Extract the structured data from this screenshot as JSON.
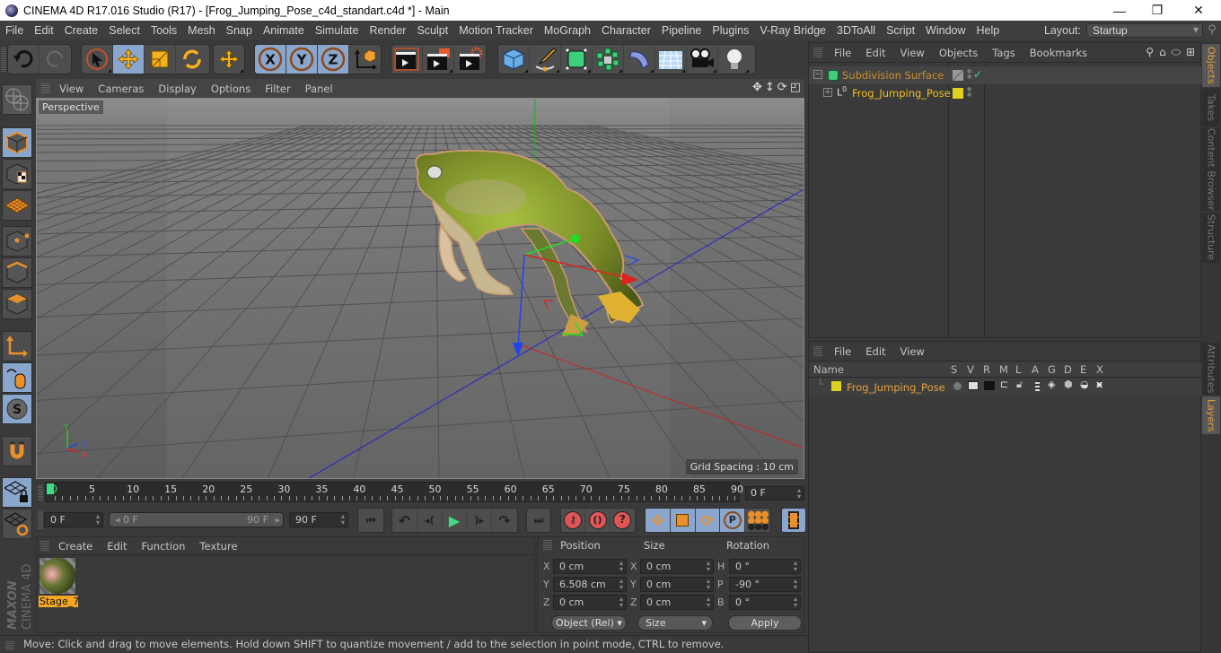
{
  "window": {
    "title": "CINEMA 4D R17.016 Studio (R17) - [Frog_Jumping_Pose_c4d_standart.c4d *] - Main",
    "controls": [
      "minimize",
      "maximize",
      "close"
    ]
  },
  "menubar": {
    "items": [
      "File",
      "Edit",
      "Create",
      "Select",
      "Tools",
      "Mesh",
      "Snap",
      "Animate",
      "Simulate",
      "Render",
      "Sculpt",
      "Motion Tracker",
      "MoGraph",
      "Character",
      "Pipeline",
      "Plugins",
      "V-Ray Bridge",
      "3DToAll",
      "Script",
      "Window",
      "Help"
    ],
    "layout_label": "Layout:",
    "layout_value": "Startup"
  },
  "toolbar": {
    "groups": [
      [
        "undo",
        "redo"
      ],
      [
        "live-selection",
        "move",
        "scale",
        "rotate"
      ],
      [
        "recent-tool-move"
      ],
      [
        "lock-x",
        "lock-y",
        "lock-z",
        "coordinate-system"
      ],
      [
        "render-view",
        "render-picture-viewer",
        "render-settings"
      ],
      [
        "cube",
        "pen",
        "subdivision-surface",
        "array",
        "bend-deformer",
        "floor",
        "camera",
        "light"
      ]
    ],
    "active": [
      "move",
      "lock-x",
      "lock-y",
      "lock-z"
    ]
  },
  "left_toolbar": {
    "items": [
      "make-editable",
      "model-mode",
      "texture-mode",
      "workplane-mode",
      "points-mode",
      "edges-mode",
      "polygons-mode",
      "axis-mode",
      "tweak-mode",
      "snapping",
      "magnet",
      "workplane-lock",
      "workplane-align"
    ],
    "active": [
      "model-mode",
      "tweak-mode",
      "snapping",
      "workplane-lock"
    ]
  },
  "viewport": {
    "menu": [
      "View",
      "Cameras",
      "Display",
      "Options",
      "Filter",
      "Panel"
    ],
    "camera_label": "Perspective",
    "grid_spacing": "Grid Spacing : 10 cm",
    "axis_labels": [
      "Y",
      "Z",
      "X"
    ]
  },
  "timeline": {
    "tick_labels": [
      "0",
      "5",
      "10",
      "15",
      "20",
      "25",
      "30",
      "35",
      "40",
      "45",
      "50",
      "55",
      "60",
      "65",
      "70",
      "75",
      "80",
      "85",
      "90"
    ],
    "current_frame": "0 F",
    "start_field": "0 F",
    "range_start": "0 F",
    "range_end": "90 F",
    "end_field": "90 F"
  },
  "playback": {
    "buttons": [
      "go-to-start",
      "prev-key",
      "prev-frame",
      "play",
      "next-frame",
      "next-key",
      "go-to-end"
    ],
    "key_buttons": [
      "record-active",
      "autokey",
      "keyframe-selection"
    ],
    "key_mode_buttons": [
      "key-position",
      "key-scale",
      "key-rotation",
      "key-parameter",
      "key-pla"
    ],
    "timeline_button": "timeline-layout"
  },
  "material_manager": {
    "menu": [
      "Create",
      "Edit",
      "Function",
      "Texture"
    ],
    "materials": [
      {
        "name": "Stage_7",
        "selected": true
      }
    ]
  },
  "coordinates": {
    "headers": [
      "Position",
      "Size",
      "Rotation"
    ],
    "position": [
      {
        "axis": "X",
        "value": "0 cm"
      },
      {
        "axis": "Y",
        "value": "6.508 cm"
      },
      {
        "axis": "Z",
        "value": "0 cm"
      }
    ],
    "size": [
      {
        "axis": "X",
        "value": "0 cm"
      },
      {
        "axis": "Y",
        "value": "0 cm"
      },
      {
        "axis": "Z",
        "value": "0 cm"
      }
    ],
    "rotation": [
      {
        "axis": "H",
        "value": "0 °"
      },
      {
        "axis": "P",
        "value": "-90 °"
      },
      {
        "axis": "B",
        "value": "0 °"
      }
    ],
    "mode_dropdown": "Object (Rel)",
    "size_dropdown": "Size",
    "apply_label": "Apply"
  },
  "brand": {
    "line1": "MAXON",
    "line2": "CINEMA 4D"
  },
  "status_bar": "Move: Click and drag to move elements. Hold down SHIFT to quantize movement / add to the selection in point mode, CTRL to remove.",
  "object_manager": {
    "menu": [
      "File",
      "Edit",
      "View",
      "Objects",
      "Tags",
      "Bookmarks"
    ],
    "objects": [
      {
        "name": "Subdivision Surface",
        "color": "#c8922a",
        "enabled": true
      },
      {
        "name": "Frog_Jumping_Pose",
        "color": "#f0c020",
        "layer_color": "#e0d020"
      }
    ]
  },
  "layer_manager": {
    "menu": [
      "File",
      "Edit",
      "View"
    ],
    "columns": [
      "Name",
      "S",
      "V",
      "R",
      "M",
      "L",
      "A",
      "G",
      "D",
      "E",
      "X"
    ],
    "layers": [
      {
        "name": "Frog_Jumping_Pose",
        "color": "#e0d020"
      }
    ]
  },
  "side_tabs": {
    "top": [
      {
        "label": "Objects",
        "active": true
      },
      {
        "label": "Takes",
        "active": false
      },
      {
        "label": "Content Browser",
        "active": false
      },
      {
        "label": "Structure",
        "active": false
      }
    ],
    "bottom": [
      {
        "label": "Attributes",
        "active": false
      },
      {
        "label": "Layers",
        "active": true
      }
    ]
  }
}
